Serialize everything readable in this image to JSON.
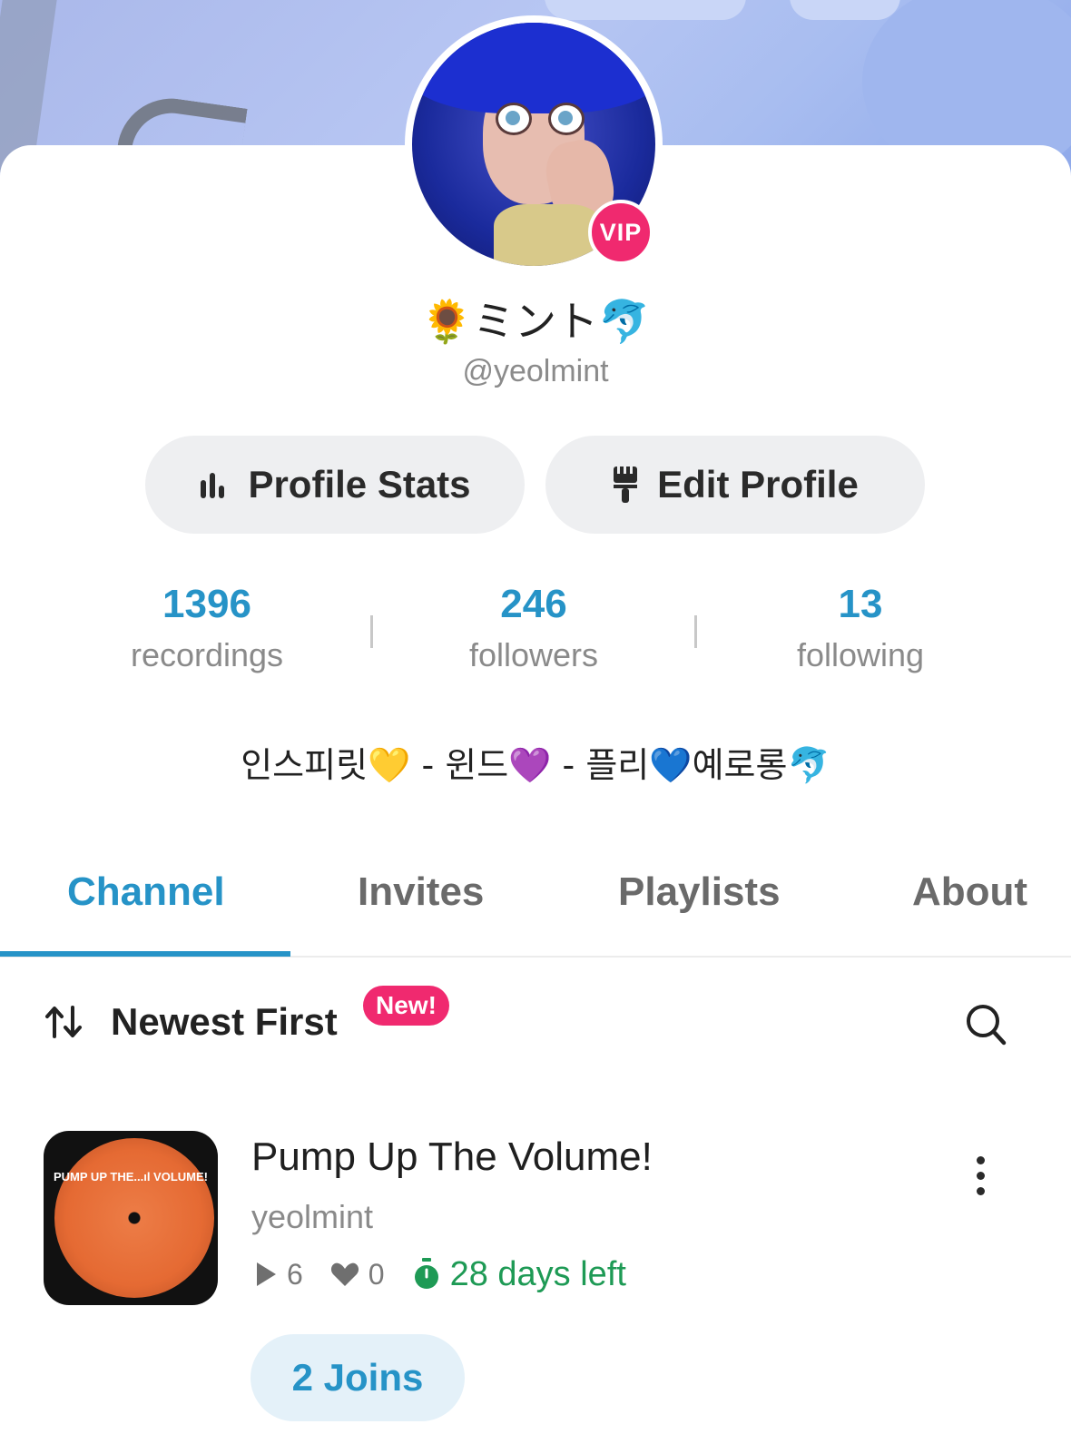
{
  "profile": {
    "display_name": "🌻ミント🐬",
    "handle": "@yeolmint",
    "vip_badge": "VIP",
    "bio": "인스피릿💛 - 윈드💜 - 플리💙예로롱🐬"
  },
  "actions": {
    "profile_stats_label": "Profile Stats",
    "edit_profile_label": "Edit Profile"
  },
  "stats": {
    "recordings": {
      "value": "1396",
      "label": "recordings"
    },
    "followers": {
      "value": "246",
      "label": "followers"
    },
    "following": {
      "value": "13",
      "label": "following"
    }
  },
  "tabs": [
    {
      "label": "Channel",
      "active": true
    },
    {
      "label": "Invites",
      "active": false
    },
    {
      "label": "Playlists",
      "active": false
    },
    {
      "label": "About",
      "active": false
    }
  ],
  "sort": {
    "label": "Newest First",
    "new_badge": "New!"
  },
  "recordings": [
    {
      "title": "Pump Up The Volume!",
      "artist": "yeolmint",
      "plays": "6",
      "loves": "0",
      "time_left": "28 days left",
      "joins": "2 Joins",
      "cover_text": "PUMP UP THE...ıl VOLUME!"
    }
  ],
  "colors": {
    "accent": "#2693c7",
    "vip": "#f0296f",
    "timer": "#1e9a55"
  }
}
